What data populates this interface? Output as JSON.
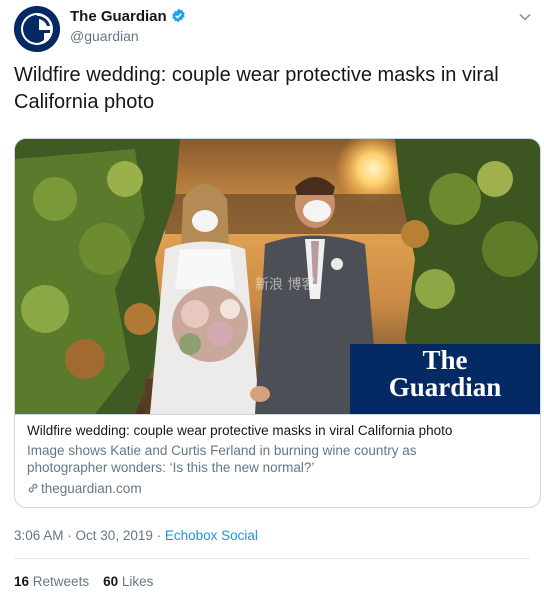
{
  "account": {
    "name": "The Guardian",
    "handle": "@guardian"
  },
  "tweet": {
    "text": "Wildfire wedding: couple wear protective masks in viral California photo"
  },
  "card": {
    "title": "Wildfire wedding: couple wear protective masks in viral California photo",
    "description": "Image shows Katie and Curtis Ferland in burning wine country as photographer wonders:  ‘Is this the new normal?’",
    "domain": "theguardian.com",
    "logo_line1": "The",
    "logo_line2": "Guardian",
    "watermark": "新浪 博客"
  },
  "meta": {
    "time": "3:06 AM",
    "date": "Oct 30, 2019",
    "source": "Echobox Social"
  },
  "stats": {
    "retweets_count": "16",
    "retweets_label": "Retweets",
    "likes_count": "60",
    "likes_label": "Likes"
  },
  "colors": {
    "guardian_blue": "#052962",
    "link_blue": "#1b95e0",
    "muted": "#657786"
  }
}
